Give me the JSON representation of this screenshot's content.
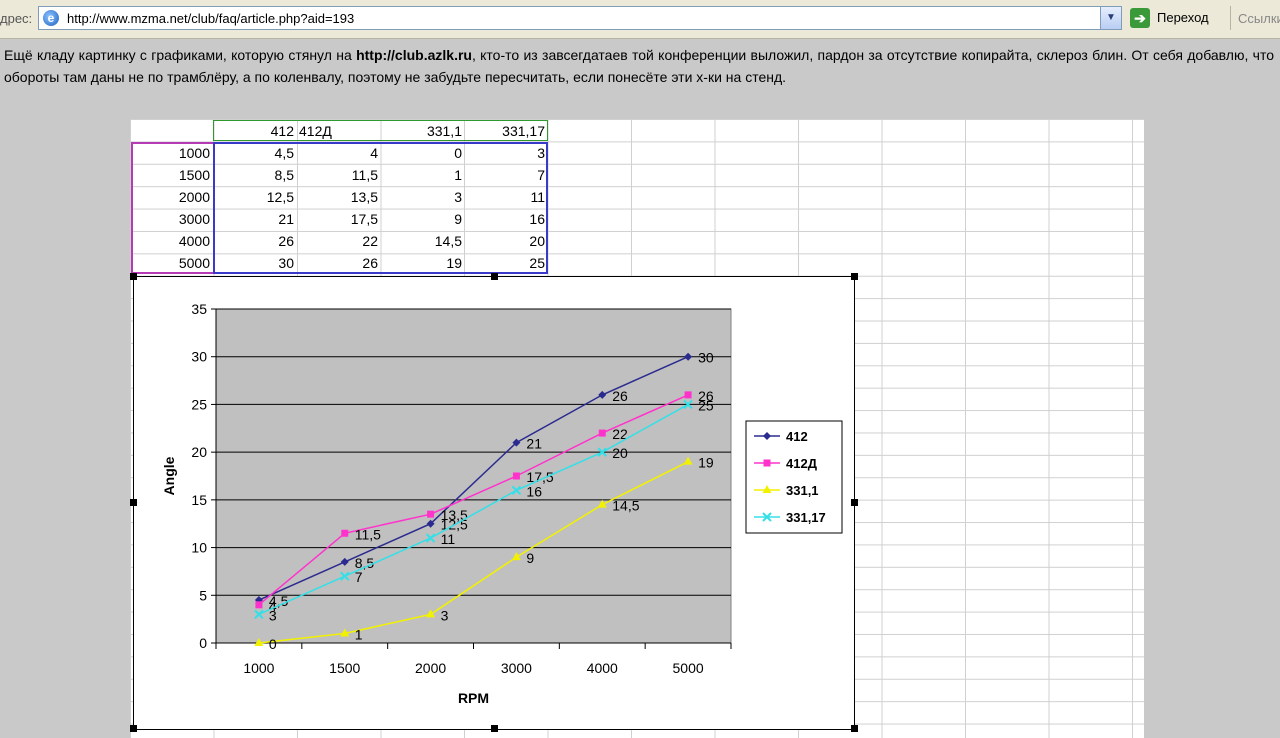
{
  "browser": {
    "address_label": "дрес:",
    "url": "http://www.mzma.net/club/faq/article.php?aid=193",
    "go_label": "Переход",
    "links_label": "Ссылки"
  },
  "article": {
    "part1": "Ещё кладу картинку с графиками, которую стянул на ",
    "link": "http://club.azlk.ru",
    "part2": ", кто-то из завсегдатаев той конференции выложил, пардон за отсутствие копирайта, склероз блин. От себя добавлю, что обороты там даны не по трамблёру, а по коленвалу, поэтому не забудьте пересчитать, если понесёте эти х-ки на стенд."
  },
  "spreadsheet": {
    "headers": [
      "412",
      "412Д",
      "331,1",
      "331,17"
    ],
    "rows": [
      {
        "rpm": "1000",
        "vals": [
          "4,5",
          "4",
          "0",
          "3"
        ]
      },
      {
        "rpm": "1500",
        "vals": [
          "8,5",
          "11,5",
          "1",
          "7"
        ]
      },
      {
        "rpm": "2000",
        "vals": [
          "12,5",
          "13,5",
          "3",
          "11"
        ]
      },
      {
        "rpm": "3000",
        "vals": [
          "21",
          "17,5",
          "9",
          "16"
        ]
      },
      {
        "rpm": "4000",
        "vals": [
          "26",
          "22",
          "14,5",
          "20"
        ]
      },
      {
        "rpm": "5000",
        "vals": [
          "30",
          "26",
          "19",
          "25"
        ]
      }
    ]
  },
  "chart_data": {
    "type": "line",
    "categories": [
      "1000",
      "1500",
      "2000",
      "3000",
      "4000",
      "5000"
    ],
    "xlabel": "RPM",
    "ylabel": "Angle",
    "ylim": [
      0,
      35
    ],
    "yticks": [
      0,
      5,
      10,
      15,
      20,
      25,
      30,
      35
    ],
    "grid": true,
    "legend": "right",
    "series": [
      {
        "name": "412",
        "values": [
          4.5,
          8.5,
          12.5,
          21,
          26,
          30
        ],
        "labels": [
          "4,5",
          "8,5",
          "12,5",
          "21",
          "26",
          "30"
        ],
        "color": "#2b2b8f",
        "marker": "diamond"
      },
      {
        "name": "412Д",
        "values": [
          4,
          11.5,
          13.5,
          17.5,
          22,
          26
        ],
        "labels": [
          "4",
          "11,5",
          "13,5",
          "17,5",
          "22",
          "26"
        ],
        "color": "#ff33cc",
        "marker": "square"
      },
      {
        "name": "331,1",
        "values": [
          0,
          1,
          3,
          9,
          14.5,
          19
        ],
        "labels": [
          "0",
          "1",
          "3",
          "9",
          "14,5",
          "19"
        ],
        "color": "#f2f200",
        "marker": "triangle"
      },
      {
        "name": "331,17",
        "values": [
          3,
          7,
          11,
          16,
          20,
          25
        ],
        "labels": [
          "3",
          "7",
          "11",
          "16",
          "20",
          "25"
        ],
        "color": "#33e0e8",
        "marker": "x"
      }
    ],
    "plot_background": "#c0c0c0"
  }
}
